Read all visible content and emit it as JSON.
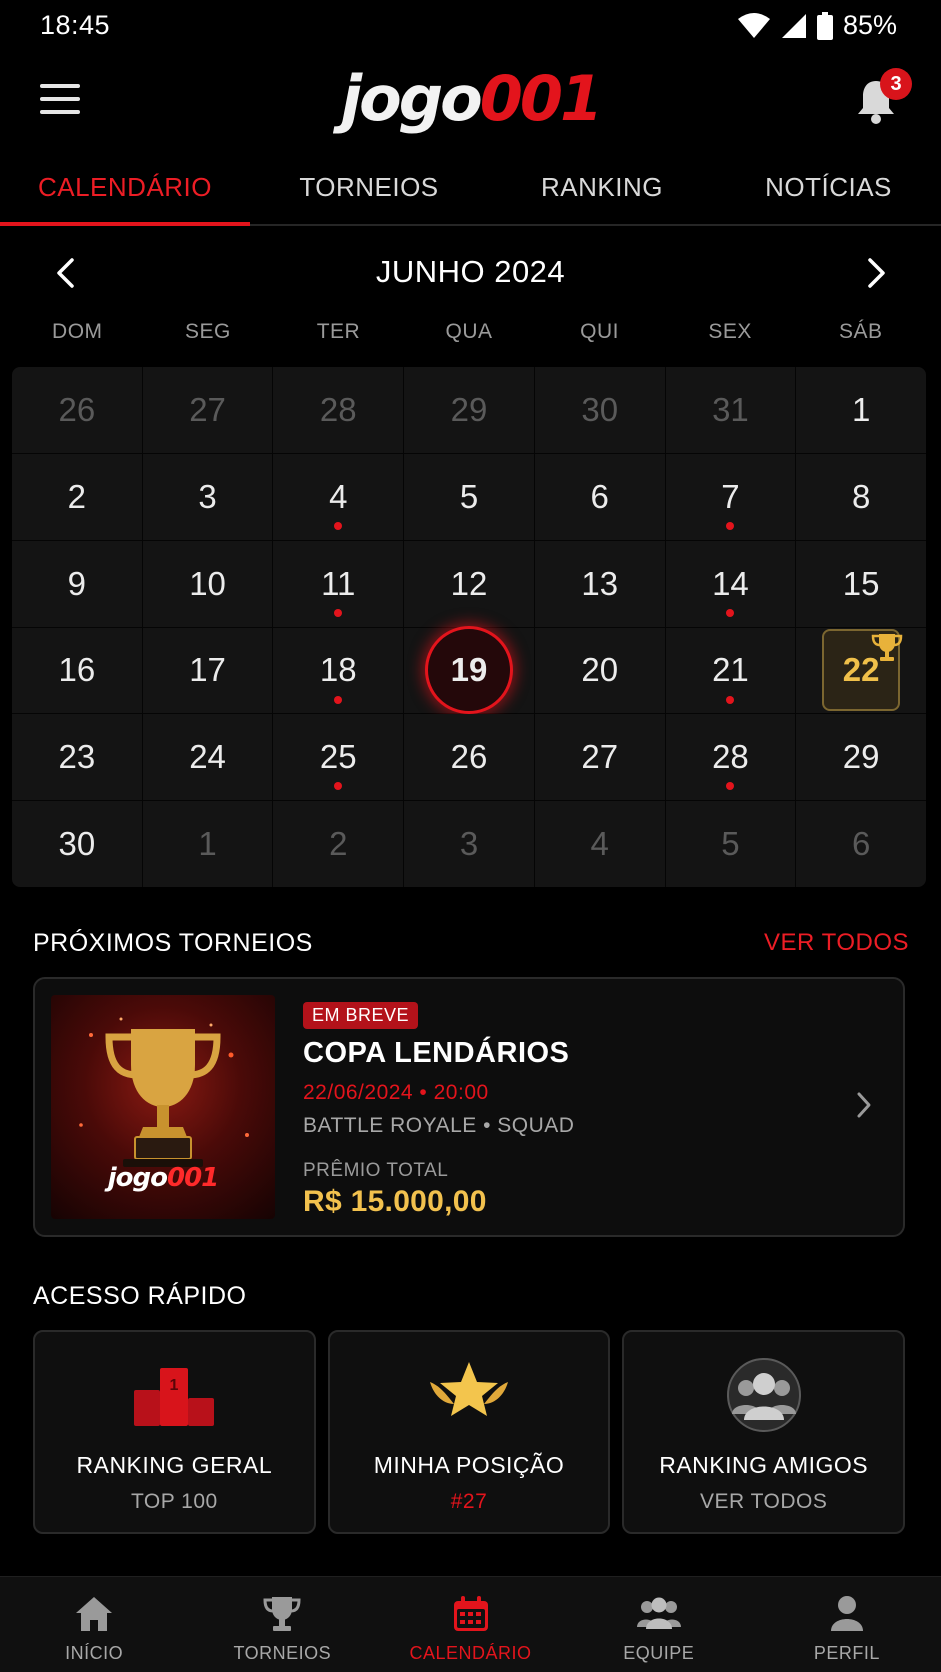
{
  "status_bar": {
    "time": "18:45",
    "battery": "85%"
  },
  "header": {
    "logo_part1": "jogo",
    "logo_part2": "001",
    "notifications_count": "3"
  },
  "tabs": [
    {
      "label": "CALENDÁRIO",
      "active": true
    },
    {
      "label": "TORNEIOS",
      "active": false
    },
    {
      "label": "RANKING",
      "active": false
    },
    {
      "label": "NOTÍCIAS",
      "active": false
    }
  ],
  "calendar": {
    "month_title": "JUNHO 2024",
    "weekdays": [
      "DOM",
      "SEG",
      "TER",
      "QUA",
      "QUI",
      "SEX",
      "SÁB"
    ],
    "weeks": [
      [
        "26",
        "27",
        "28",
        "29",
        "30",
        "31",
        "1"
      ],
      [
        "2",
        "3",
        "4",
        "5",
        "6",
        "7",
        "8"
      ],
      [
        "9",
        "10",
        "11",
        "12",
        "13",
        "14",
        "15"
      ],
      [
        "16",
        "17",
        "18",
        "19",
        "20",
        "21",
        "22"
      ],
      [
        "23",
        "24",
        "25",
        "26",
        "27",
        "28",
        "29"
      ],
      [
        "30",
        "1",
        "2",
        "3",
        "4",
        "5",
        "6"
      ]
    ],
    "today": "19",
    "tournament_day": "22",
    "event_days": [
      "4",
      "7",
      "11",
      "14",
      "18",
      "21",
      "25",
      "28"
    ]
  },
  "upcoming": {
    "title": "PRÓXIMOS TORNEIOS",
    "see_all": "VER TODOS",
    "card": {
      "badge": "EM BREVE",
      "name": "COPA LENDÁRIOS",
      "datetime": "22/06/2024 • 20:00",
      "mode": "BATTLE ROYALE • SQUAD",
      "prize_label": "PRÊMIO TOTAL",
      "prize_value": "R$ 15.000,00",
      "thumb_logo_part1": "jogo",
      "thumb_logo_part2": "001"
    }
  },
  "quick_access": {
    "title": "ACESSO RÁPIDO",
    "items": [
      {
        "title": "RANKING GERAL",
        "subtitle": "TOP 100",
        "icon": "podium-icon"
      },
      {
        "title": "MINHA POSIÇÃO",
        "subtitle": "#27",
        "icon": "winged-star-icon"
      },
      {
        "title": "RANKING AMIGOS",
        "subtitle": "VER TODOS",
        "icon": "group-icon"
      }
    ]
  },
  "bottom_nav": [
    {
      "label": "INÍCIO",
      "icon": "home-icon"
    },
    {
      "label": "TORNEIOS",
      "icon": "trophy-icon"
    },
    {
      "label": "CALENDÁRIO",
      "icon": "calendar-icon",
      "active": true
    },
    {
      "label": "EQUIPE",
      "icon": "team-icon"
    },
    {
      "label": "PERFIL",
      "icon": "profile-icon"
    }
  ],
  "colors": {
    "accent": "#e3141c",
    "gold": "#f2c14e",
    "background": "#000000"
  }
}
